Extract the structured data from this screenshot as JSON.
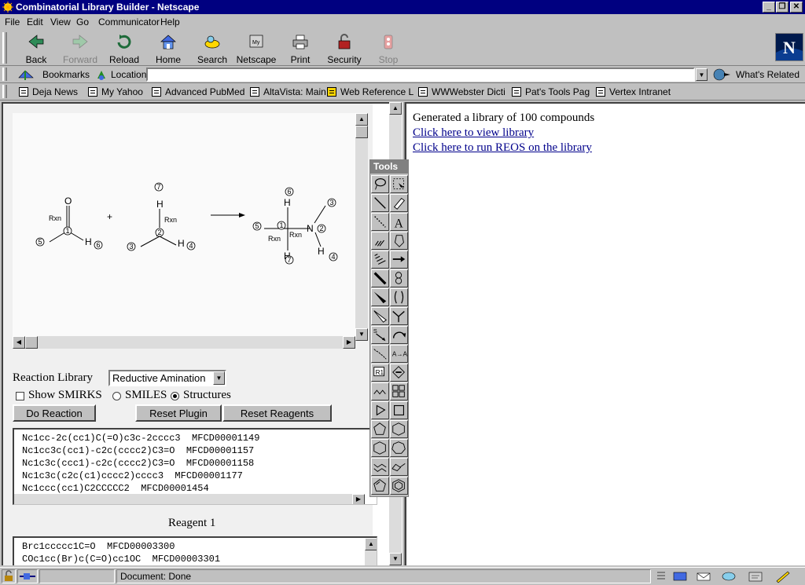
{
  "window": {
    "title": "Combinatorial Library Builder - Netscape"
  },
  "menu": [
    "File",
    "Edit",
    "View",
    "Go",
    "Communicator",
    "Help"
  ],
  "toolbar": [
    {
      "label": "Back",
      "icon": "back-icon",
      "enabled": true
    },
    {
      "label": "Forward",
      "icon": "forward-icon",
      "enabled": false
    },
    {
      "label": "Reload",
      "icon": "reload-icon",
      "enabled": true
    },
    {
      "label": "Home",
      "icon": "home-icon",
      "enabled": true
    },
    {
      "label": "Search",
      "icon": "search-icon",
      "enabled": true
    },
    {
      "label": "Netscape",
      "icon": "netscape-icon",
      "enabled": true
    },
    {
      "label": "Print",
      "icon": "print-icon",
      "enabled": true
    },
    {
      "label": "Security",
      "icon": "security-icon",
      "enabled": true
    },
    {
      "label": "Stop",
      "icon": "stop-icon",
      "enabled": false
    }
  ],
  "location": {
    "bookmarks": "Bookmarks",
    "label": "Location:",
    "value": "",
    "related": "What's Related"
  },
  "personal_bar": [
    "Deja News",
    "My Yahoo",
    "Advanced PubMed",
    "AltaVista: Main",
    "Web Reference L",
    "WWWebster Dicti",
    "Pat's Tools Pag",
    "Vertex Intranet"
  ],
  "reaction": {
    "plus": "+",
    "rxn": "Rxn",
    "labels": {
      "o": "O",
      "h": "H",
      "n": "N",
      "one": "1",
      "two": "2",
      "three": "3",
      "four": "4",
      "five": "5",
      "six": "6",
      "seven": "7"
    }
  },
  "controls": {
    "library_label": "Reaction Library",
    "library_value": "Reductive Amination",
    "show_smirks": "Show SMIRKS",
    "smiles": "SMILES",
    "structures": "Structures",
    "do_reaction": "Do Reaction",
    "reset_plugin": "Reset Plugin",
    "reset_reagents": "Reset Reagents"
  },
  "reagent_list_1": [
    "Nc1cc-2c(cc1)C(=O)c3c-2cccc3  MFCD00001149",
    "Nc1cc3c(cc1)-c2c(cccc2)C3=O  MFCD00001157",
    "Nc1c3c(ccc1)-c2c(cccc2)C3=O  MFCD00001158",
    "Nc1c3c(c2c(c1)cccc2)cccc3  MFCD00001177",
    "Nc1ccc(cc1)C2CCCCC2  MFCD00001454"
  ],
  "reagent1_label": "Reagent 1",
  "reagent_list_2": [
    "Brc1ccccc1C=O  MFCD00003300",
    "COc1cc(Br)c(C=O)cc1OC  MFCD00003301"
  ],
  "tools": {
    "title": "Tools"
  },
  "right": {
    "message": "Generated a library of 100 compounds",
    "link1": "Click here to view library",
    "link2": "Click here to run REOS on the library"
  },
  "status": {
    "text": "Document: Done"
  }
}
